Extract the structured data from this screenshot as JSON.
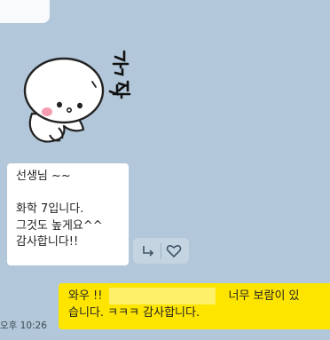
{
  "messages": {
    "received": {
      "text": "선생님 ~~\n\n화학 7입니다.\n그것도 높게요^^\n감사합니다!!"
    },
    "sent": {
      "line1_start": "와우 !!",
      "line1_end": "너무 보람이 있",
      "line2": "습니다. ㅋㅋㅋ 감사합니다.",
      "time": "오후 10:26"
    }
  },
  "sticker": {
    "caption": "깜짝",
    "icon": "surprised-character-sticker"
  },
  "actions": {
    "reply_icon": "reply-arrow-icon",
    "like_icon": "heart-icon"
  },
  "colors": {
    "background": "#b2c7d9",
    "received_bubble": "#ffffff",
    "sent_bubble": "#fee500"
  }
}
